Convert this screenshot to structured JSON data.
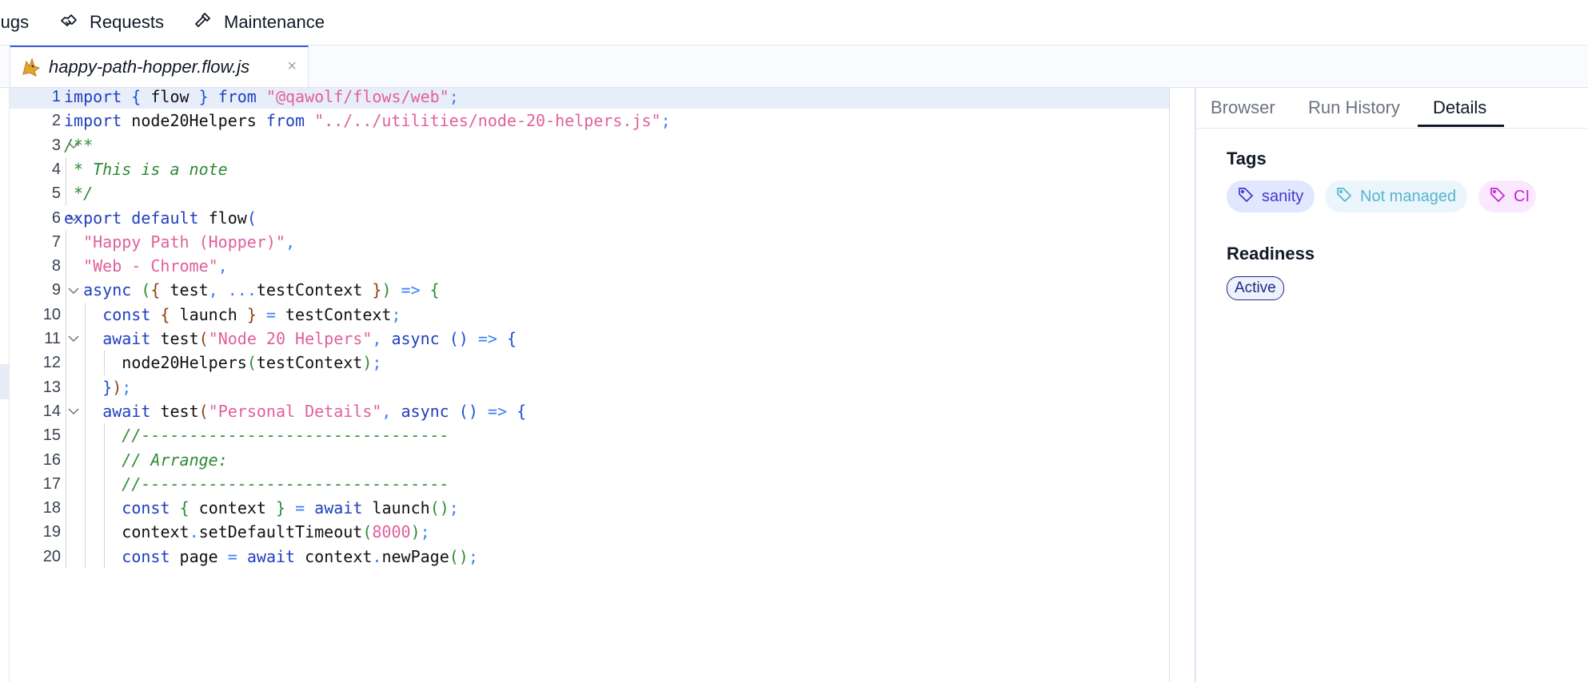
{
  "nav": {
    "items": [
      {
        "label": "Bugs",
        "icon": "bug-icon"
      },
      {
        "label": "Requests",
        "icon": "handshake-icon"
      },
      {
        "label": "Maintenance",
        "icon": "hammer-icon"
      }
    ]
  },
  "editor": {
    "tab": {
      "filename": "happy-path-hopper.flow.js",
      "close": "×",
      "icon": "qawolf-logo-icon"
    }
  },
  "right_panel": {
    "tabs": [
      {
        "label": "Browser"
      },
      {
        "label": "Run History"
      },
      {
        "label": "Details"
      }
    ],
    "selected_tab": "Details",
    "tags_title": "Tags",
    "tags": [
      {
        "label": "sanity",
        "color": "#4338ca",
        "bg": "#e0e7ff"
      },
      {
        "label": "Not managed",
        "color": "#5ab4cf",
        "bg": "#eaf6fb"
      },
      {
        "label": "CI",
        "color": "#c026d3",
        "bg": "#fae8ff"
      }
    ],
    "readiness_title": "Readiness",
    "readiness_value": "Active"
  },
  "colors": {
    "keyword": "#1f3fbf",
    "string": "#e0609b",
    "comment": "#2e8b36",
    "active_line": "#e8eef9",
    "tab_accent": "#3b5bdb"
  }
}
